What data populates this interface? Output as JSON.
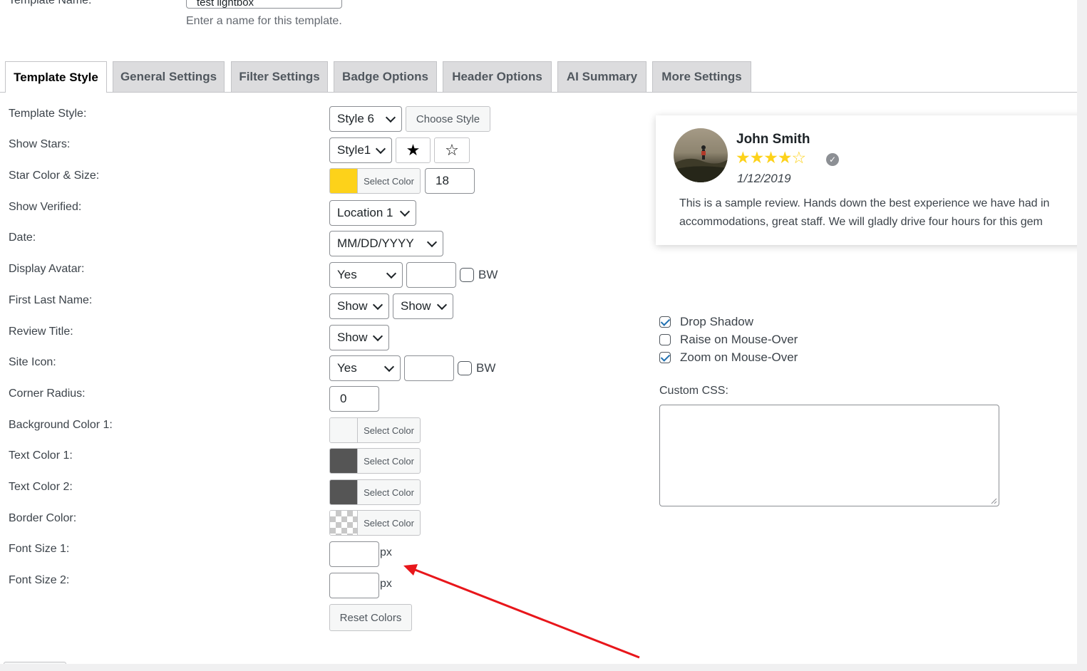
{
  "header": {
    "template_name_label": "Template Name:",
    "template_name_value": "test lightbox",
    "template_name_help": "Enter a name for this template."
  },
  "tabs": [
    {
      "label": "Template Style",
      "active": true
    },
    {
      "label": "General Settings",
      "active": false
    },
    {
      "label": "Filter Settings",
      "active": false
    },
    {
      "label": "Badge Options",
      "active": false
    },
    {
      "label": "Header Options",
      "active": false
    },
    {
      "label": "AI Summary",
      "active": false
    },
    {
      "label": "More Settings",
      "active": false
    }
  ],
  "form": {
    "labels": {
      "template_style": "Template Style:",
      "show_stars": "Show Stars:",
      "star_color_size": "Star Color & Size:",
      "show_verified": "Show Verified:",
      "date": "Date:",
      "display_avatar": "Display Avatar:",
      "first_last_name": "First Last Name:",
      "review_title": "Review Title:",
      "site_icon": "Site Icon:",
      "corner_radius": "Corner Radius:",
      "background_color_1": "Background Color 1:",
      "text_color_1": "Text Color 1:",
      "text_color_2": "Text Color 2:",
      "border_color": "Border Color:",
      "font_size_1": "Font Size 1:",
      "font_size_2": "Font Size 2:"
    },
    "template_style_value": "Style 6",
    "choose_style_label": "Choose Style",
    "show_stars_value": "Style1",
    "star_filled_glyph": "★",
    "star_empty_glyph": "☆",
    "select_color_label": "Select Color",
    "star_size_value": "18",
    "show_verified_value": "Location 1",
    "date_value": "MM/DD/YYYY",
    "display_avatar_value": "Yes",
    "bw_label": "BW",
    "first_name_value": "Show",
    "last_name_value": "Show",
    "review_title_value": "Show",
    "site_icon_value": "Yes",
    "corner_radius_value": "0",
    "px_label": "px",
    "reset_colors_label": "Reset Colors",
    "colors": {
      "star": "#fdd21a",
      "background_1": "#f6f7f7",
      "text_1": "#555555",
      "text_2": "#555555"
    }
  },
  "preview": {
    "name": "John Smith",
    "stars": "★★★★☆",
    "date": "1/12/2019",
    "text_line1": "This is a sample review. Hands down the best experience we have had in",
    "text_line2": "accommodations, great staff. We will gladly drive four hours for this gem"
  },
  "options": {
    "drop_shadow": {
      "label": "Drop Shadow",
      "checked": true
    },
    "raise_mouseover": {
      "label": "Raise on Mouse-Over",
      "checked": false
    },
    "zoom_mouseover": {
      "label": "Zoom on Mouse-Over",
      "checked": true
    },
    "custom_css_label": "Custom CSS:",
    "custom_css_value": ""
  },
  "annotation": {
    "arrow_color": "#e8161b"
  }
}
